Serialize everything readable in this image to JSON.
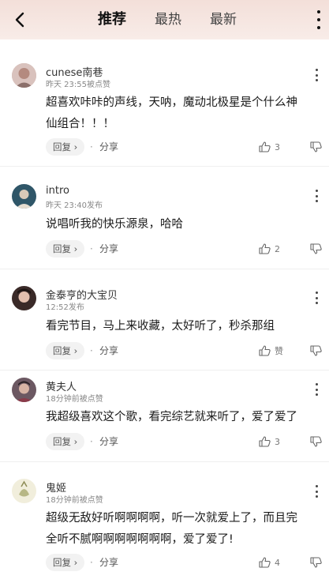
{
  "header": {
    "tabs": [
      {
        "label": "推荐",
        "active": true
      },
      {
        "label": "最热",
        "active": false
      },
      {
        "label": "最新",
        "active": false
      }
    ]
  },
  "comments": [
    {
      "username": "cunese南巷",
      "meta": "昨天 23:55被点赞",
      "text_lines": [
        "超喜欢咔咔的声线，天呐，魔动北极星是个什么神",
        "仙组合！！！"
      ],
      "reply_label": "回复",
      "share_label": "分享",
      "likes": "3",
      "avatar_color": "#c9a9a6"
    },
    {
      "username": "intro",
      "meta": "昨天 23:40发布",
      "text_lines": [
        "说唱听我的快乐源泉，哈哈"
      ],
      "reply_label": "回复",
      "share_label": "分享",
      "likes": "2",
      "avatar_color": "#3c5a6e"
    },
    {
      "username": "金泰亨的大宝贝",
      "meta": "12:52发布",
      "text_lines": [
        "看完节目，马上来收藏，太好听了，秒杀那组"
      ],
      "reply_label": "回复",
      "share_label": "分享",
      "likes": "赞",
      "avatar_color": "#6b4a42"
    },
    {
      "username": "黄夫人",
      "meta": "18分钟前被点赞",
      "text_lines": [
        "我超级喜欢这个歌，看完综艺就来听了，爱了爱了"
      ],
      "reply_label": "回复",
      "share_label": "分享",
      "likes": "3",
      "avatar_color": "#5d4a52"
    },
    {
      "username": "鬼姬",
      "meta": "18分钟前被点赞",
      "text_lines": [
        "超级无敌好听啊啊啊啊，听一次就爱上了，而且完",
        "全听不腻啊啊啊啊啊啊啊，爱了爱了!"
      ],
      "reply_label": "回复",
      "share_label": "分享",
      "likes": "4",
      "avatar_color": "#e8e4cf"
    }
  ]
}
